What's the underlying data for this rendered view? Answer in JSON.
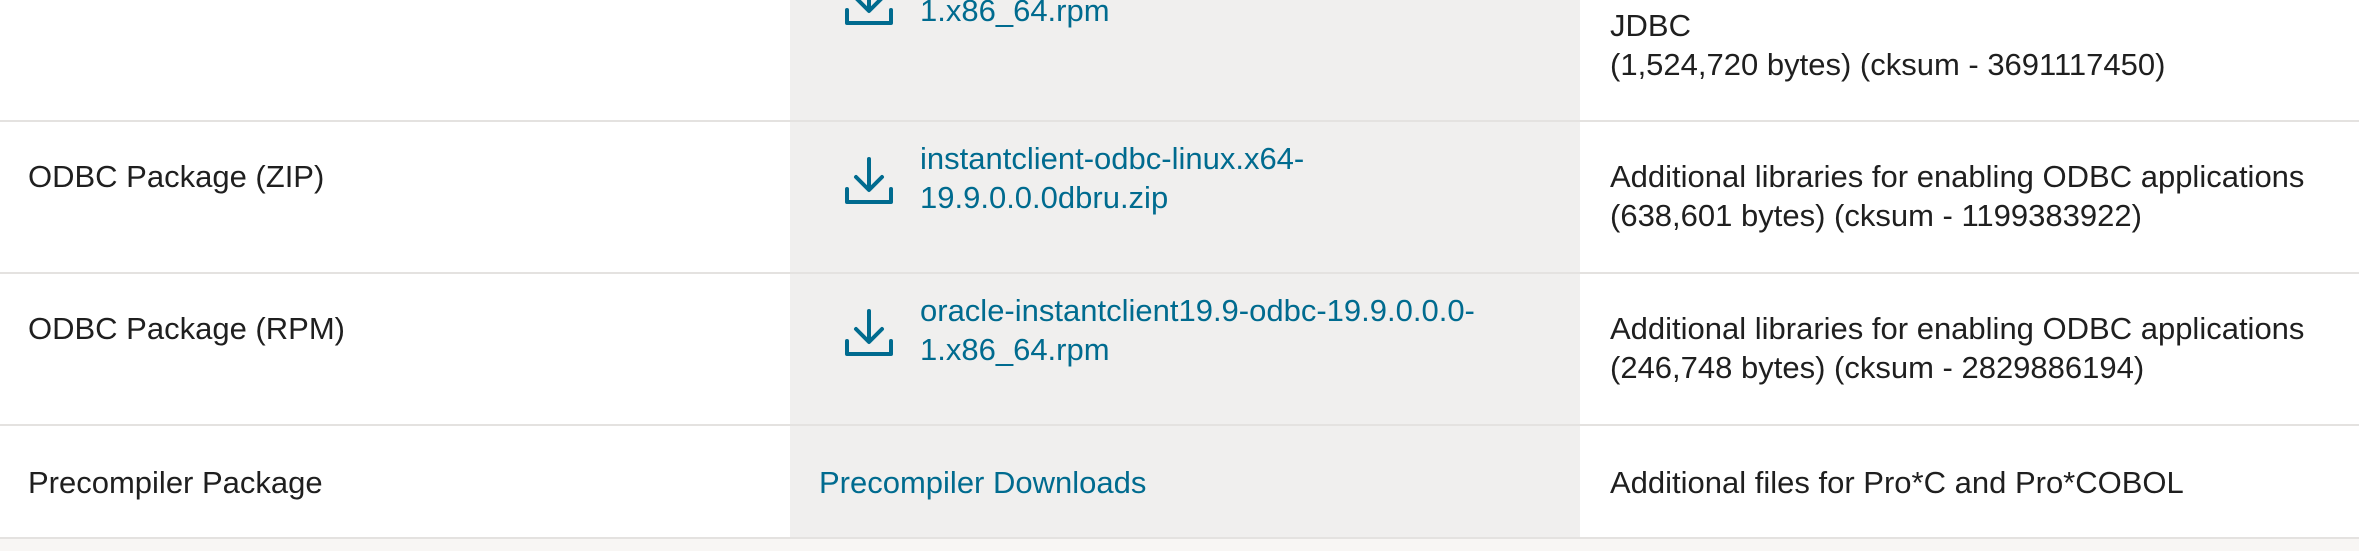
{
  "rows": [
    {
      "package": "ODBC Package (ZIP)",
      "download_line1": "instantclient-odbc-linux.x64-",
      "download_line2": "19.9.0.0.0dbru.zip",
      "desc_line1": "Additional libraries for enabling ODBC applications",
      "desc_line2": "(638,601 bytes) (cksum - 1199383922)"
    },
    {
      "package": "ODBC Package (RPM)",
      "download_line1": "oracle-instantclient19.9-odbc-19.9.0.0.0-",
      "download_line2": "1.x86_64.rpm",
      "desc_line1": "Additional libraries for enabling ODBC applications",
      "desc_line2": "(246,748 bytes) (cksum - 2829886194)"
    },
    {
      "package": "Precompiler Package",
      "download_link": "Precompiler Downloads",
      "desc_line1": "Additional files for Pro*C and Pro*COBOL"
    }
  ],
  "top_partial": {
    "download_line2": "1.x86_64.rpm",
    "desc_line2": "JDBC",
    "desc_line3": "(1,524,720 bytes) (cksum - 3691117450)"
  },
  "icons": {
    "download": "download-icon"
  },
  "colors": {
    "link": "#006b8f",
    "middle_column_bg": "#f0efee",
    "divider": "#e4e2e0"
  }
}
